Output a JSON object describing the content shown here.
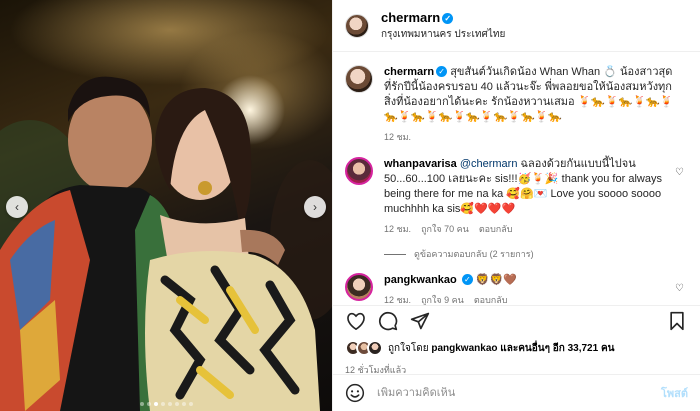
{
  "photo": {
    "alt_icon_prev": "chevron-left-icon",
    "alt_icon_next": "chevron-right-icon",
    "carousel_count": 8,
    "carousel_active_index": 2
  },
  "header": {
    "username": "chermarn",
    "location": "กรุงเทพมหานคร ประเทศไทย"
  },
  "caption": {
    "username": "chermarn",
    "text": "สุขสันต์วันเกิดน้อง Whan Whan 💍 น้องสาวสุดที่รักปีนี้น้องครบรอบ 40 แล้วนะจ๊ะ พี่พลอยขอให้น้องสมหวังทุกสิ่งที่น้องอยากได้นะคะ รักน้องหวานเสมอ 🍹🐆🍹🐆🍹🐆🍹🐆🍹🐆🍹🐆🍹🐆🍹🐆🍹🐆🍹🐆",
    "time": "12 ชม."
  },
  "comments": [
    {
      "username": "whanpavarisa",
      "mention": "@chermarn",
      "text": " ฉลองด้วยกันแบบนี้ไปจน 50...60...100 เลยนะคะ sis!!!🥳🍹🎉 thank you for always being there for me na ka 🥰🤗💌 Love you soooo soooo muchhhh ka sis🥰❤️❤️❤️",
      "time": "12 ชม.",
      "likes": "ถูกใจ 70 คน",
      "reply": "ตอบกลับ",
      "view_replies": "ดูข้อความตอบกลับ (2 รายการ)"
    },
    {
      "username": "pangkwankao",
      "text": "🦁🦁🤎",
      "time": "12 ชม.",
      "likes": "ถูกใจ 9 คน",
      "reply": "ตอบกลับ"
    }
  ],
  "likes_summary": {
    "text": "ถูกใจโดย ",
    "user": "pangkwankao",
    "rest": " และคนอื่นๆ อีก 33,721 คน"
  },
  "timestamp": "12 ชั่วโมงที่แล้ว",
  "add_comment": {
    "placeholder": "เพิ่มความคิดเห็น",
    "post_label": "โพสต์"
  },
  "colors": {
    "accent": "#0095f6",
    "link": "#00376b",
    "post_disabled": "#b2dffc"
  }
}
